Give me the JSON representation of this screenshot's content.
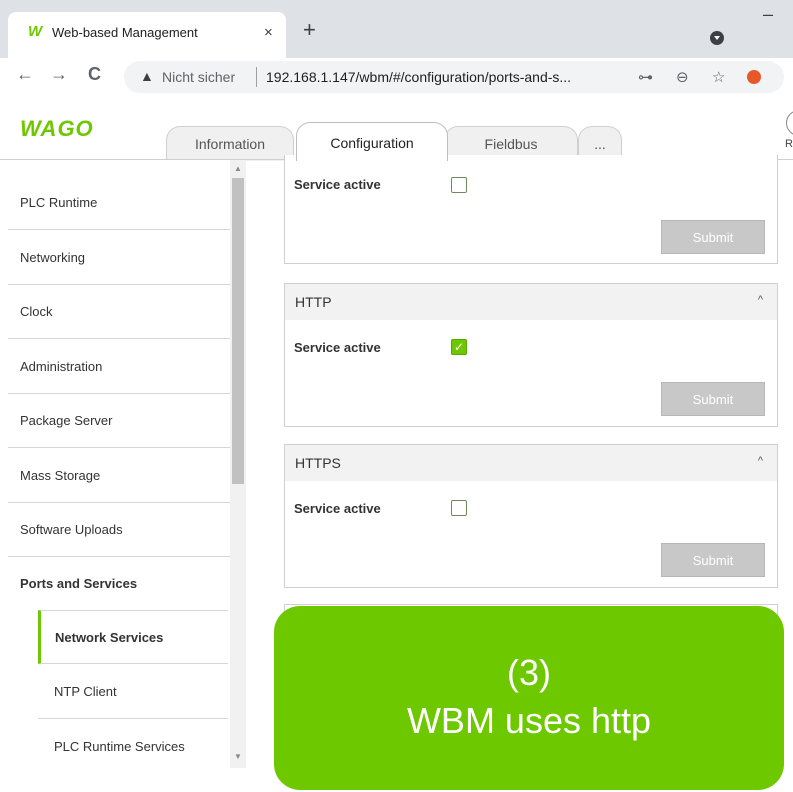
{
  "browser": {
    "tab_title": "Web-based Management",
    "tab_logo": "W",
    "close_glyph": "×",
    "new_tab_glyph": "+",
    "minimize_glyph": "–",
    "back_glyph": "←",
    "forward_glyph": "→",
    "reload_glyph": "C",
    "warning_glyph": "▲",
    "security_label": "Nicht sicher",
    "url": "192.168.1.147/wbm/#/configuration/ports-and-s...",
    "key_icon": "key-icon",
    "zoom_icon": "zoom-icon",
    "star_icon": "star-icon"
  },
  "header": {
    "logo": "WAGO",
    "tabs": [
      {
        "label": "Information"
      },
      {
        "label": "Configuration"
      },
      {
        "label": "Fieldbus"
      },
      {
        "label": "..."
      }
    ],
    "active_tab": "Configuration",
    "right_label": "R"
  },
  "sidebar": {
    "items": [
      {
        "label": "PLC Runtime"
      },
      {
        "label": "Networking"
      },
      {
        "label": "Clock"
      },
      {
        "label": "Administration"
      },
      {
        "label": "Package Server"
      },
      {
        "label": "Mass Storage"
      },
      {
        "label": "Software Uploads"
      },
      {
        "label": "Ports and Services"
      }
    ],
    "sub_items": [
      {
        "label": "Network Services"
      },
      {
        "label": "NTP Client"
      },
      {
        "label": "PLC Runtime Services"
      }
    ],
    "active_sub": "Network Services",
    "scroll_up": "▲",
    "scroll_down": "▼"
  },
  "panels": [
    {
      "title": "",
      "service_label": "Service active",
      "checked": false,
      "submit_label": "Submit"
    },
    {
      "title": "HTTP",
      "service_label": "Service active",
      "checked": true,
      "submit_label": "Submit"
    },
    {
      "title": "HTTPS",
      "service_label": "Service active",
      "checked": false,
      "submit_label": "Submit"
    }
  ],
  "chevron_glyph": "^",
  "check_glyph": "✓",
  "callout": {
    "line1": "(3)",
    "line2": "WBM uses http"
  },
  "colors": {
    "accent": "#6ec800",
    "submit_disabled": "#c8c8c8"
  }
}
